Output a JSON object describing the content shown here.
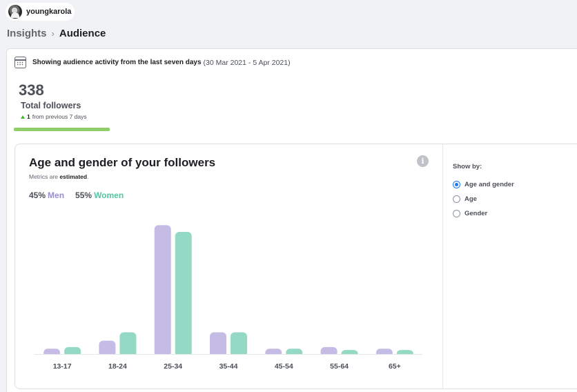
{
  "account": {
    "username": "youngkarola"
  },
  "breadcrumb": {
    "root": "Insights",
    "separator": "›",
    "current": "Audience"
  },
  "activity": {
    "lead": "Showing audience activity from the last seven days",
    "dates": "(30 Mar 2021 - 5 Apr 2021)"
  },
  "followers": {
    "count": "338",
    "label": "Total followers",
    "delta_value": "1",
    "delta_text": "from previous 7 days",
    "progress_fraction": 1.0
  },
  "chart_panel": {
    "title": "Age and gender of your followers",
    "note_prefix": "Metrics are",
    "note_bold": "estimated",
    "note_suffix": ".",
    "info_icon": "i",
    "men_pct": "45%",
    "men_label": "Men",
    "women_pct": "55%",
    "women_label": "Women"
  },
  "show_by": {
    "title": "Show by:",
    "options": [
      {
        "label": "Age and gender",
        "selected": true
      },
      {
        "label": "Age",
        "selected": false
      },
      {
        "label": "Gender",
        "selected": false
      }
    ]
  },
  "colors": {
    "men": "#c5bce5",
    "women": "#94d9c4",
    "accent": "#1877f2",
    "progress": "#8fce6b"
  },
  "chart_data": {
    "type": "bar",
    "categories": [
      "13-17",
      "18-24",
      "25-34",
      "35-44",
      "45-54",
      "55-64",
      "65+"
    ],
    "series": [
      {
        "name": "Men",
        "values": [
          1.6,
          4.0,
          38.5,
          6.5,
          1.6,
          2.1,
          1.6
        ]
      },
      {
        "name": "Women",
        "values": [
          2.1,
          6.5,
          36.5,
          6.5,
          1.6,
          1.2,
          1.2
        ]
      }
    ],
    "ylim": [
      0,
      40
    ],
    "grid": false,
    "legend": "top-left"
  }
}
